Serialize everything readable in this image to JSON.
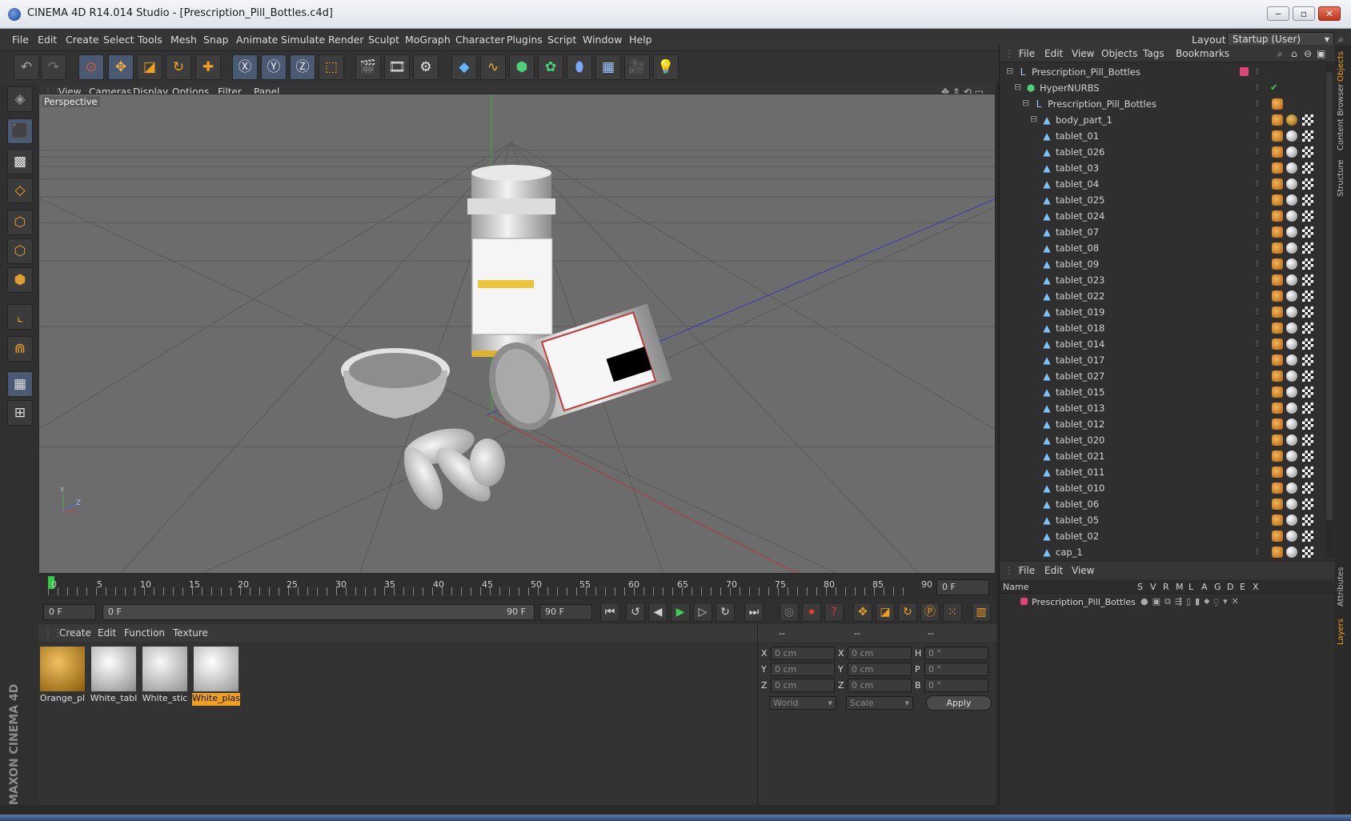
{
  "window": {
    "title": "CINEMA 4D R14.014 Studio - [Prescription_Pill_Bottles.c4d]",
    "minimize": "‒",
    "maximize": "▫",
    "close": "✕"
  },
  "menubar": {
    "items": [
      "File",
      "Edit",
      "Create",
      "Select",
      "Tools",
      "Mesh",
      "Snap",
      "Animate",
      "Simulate",
      "Render",
      "Sculpt",
      "MoGraph",
      "Character",
      "Plugins",
      "Script",
      "Window",
      "Help"
    ],
    "layout_label": "Layout:",
    "layout_value": "Startup (User)"
  },
  "viewport": {
    "menu": [
      "View",
      "Cameras",
      "Display",
      "Options",
      "Filter",
      "Panel"
    ],
    "label": "Perspective",
    "axis_y": "Y",
    "axis_z": "Z"
  },
  "timeline": {
    "ticks": [
      "0",
      "5",
      "10",
      "15",
      "20",
      "25",
      "30",
      "35",
      "40",
      "45",
      "50",
      "55",
      "60",
      "65",
      "70",
      "75",
      "80",
      "85",
      "90"
    ],
    "current_frame": "0 F"
  },
  "transport": {
    "start_field": "0 F",
    "range_start": "0 F",
    "range_end": "90 F",
    "end_field": "90 F"
  },
  "material_manager": {
    "menu": [
      "Create",
      "Edit",
      "Function",
      "Texture"
    ],
    "materials": [
      {
        "label": "Orange_pl",
        "color": "#c98b1a",
        "selected": false
      },
      {
        "label": "White_tabl",
        "color": "#d9d9d9",
        "selected": false
      },
      {
        "label": "White_stic",
        "color": "#cfcfcf",
        "selected": false
      },
      {
        "label": "White_plas",
        "color": "#dedede",
        "selected": true
      }
    ]
  },
  "coordinates": {
    "headers": [
      "--",
      "--",
      "--"
    ],
    "rows": [
      {
        "a": "X",
        "av": "0 cm",
        "b": "X",
        "bv": "0 cm",
        "c": "H",
        "cv": "0 °"
      },
      {
        "a": "Y",
        "av": "0 cm",
        "b": "Y",
        "bv": "0 cm",
        "c": "P",
        "cv": "0 °"
      },
      {
        "a": "Z",
        "av": "0 cm",
        "b": "Z",
        "bv": "0 cm",
        "c": "B",
        "cv": "0 °"
      }
    ],
    "space": "World",
    "mode": "Scale",
    "apply": "Apply"
  },
  "object_manager": {
    "menu": [
      "File",
      "Edit",
      "View",
      "Objects",
      "Tags",
      "Bookmarks"
    ],
    "objects": [
      {
        "name": "Prescription_Pill_Bottles",
        "indent": 0,
        "icon": "null"
      },
      {
        "name": "HyperNURBS",
        "indent": 1,
        "icon": "nurbs"
      },
      {
        "name": "Prescription_Pill_Bottles",
        "indent": 2,
        "icon": "null"
      },
      {
        "name": "body_part_1",
        "indent": 3,
        "icon": "poly"
      },
      {
        "name": "tablet_01",
        "indent": 3,
        "icon": "poly"
      },
      {
        "name": "tablet_026",
        "indent": 3,
        "icon": "poly"
      },
      {
        "name": "tablet_03",
        "indent": 3,
        "icon": "poly"
      },
      {
        "name": "tablet_04",
        "indent": 3,
        "icon": "poly"
      },
      {
        "name": "tablet_025",
        "indent": 3,
        "icon": "poly"
      },
      {
        "name": "tablet_024",
        "indent": 3,
        "icon": "poly"
      },
      {
        "name": "tablet_07",
        "indent": 3,
        "icon": "poly"
      },
      {
        "name": "tablet_08",
        "indent": 3,
        "icon": "poly"
      },
      {
        "name": "tablet_09",
        "indent": 3,
        "icon": "poly"
      },
      {
        "name": "tablet_023",
        "indent": 3,
        "icon": "poly"
      },
      {
        "name": "tablet_022",
        "indent": 3,
        "icon": "poly"
      },
      {
        "name": "tablet_019",
        "indent": 3,
        "icon": "poly"
      },
      {
        "name": "tablet_018",
        "indent": 3,
        "icon": "poly"
      },
      {
        "name": "tablet_014",
        "indent": 3,
        "icon": "poly"
      },
      {
        "name": "tablet_017",
        "indent": 3,
        "icon": "poly"
      },
      {
        "name": "tablet_027",
        "indent": 3,
        "icon": "poly"
      },
      {
        "name": "tablet_015",
        "indent": 3,
        "icon": "poly"
      },
      {
        "name": "tablet_013",
        "indent": 3,
        "icon": "poly"
      },
      {
        "name": "tablet_012",
        "indent": 3,
        "icon": "poly"
      },
      {
        "name": "tablet_020",
        "indent": 3,
        "icon": "poly"
      },
      {
        "name": "tablet_021",
        "indent": 3,
        "icon": "poly"
      },
      {
        "name": "tablet_011",
        "indent": 3,
        "icon": "poly"
      },
      {
        "name": "tablet_010",
        "indent": 3,
        "icon": "poly"
      },
      {
        "name": "tablet_06",
        "indent": 3,
        "icon": "poly"
      },
      {
        "name": "tablet_05",
        "indent": 3,
        "icon": "poly"
      },
      {
        "name": "tablet_02",
        "indent": 3,
        "icon": "poly"
      },
      {
        "name": "cap_1",
        "indent": 3,
        "icon": "poly"
      }
    ]
  },
  "layer_manager": {
    "menu": [
      "File",
      "Edit",
      "View"
    ],
    "columns": [
      "Name",
      "S",
      "V",
      "R",
      "M",
      "L",
      "A",
      "G",
      "D",
      "E",
      "X"
    ],
    "layers": [
      {
        "name": "Prescription_Pill_Bottles",
        "color": "#e0457a"
      }
    ]
  },
  "right_tabs": [
    "Objects",
    "Content Browser",
    "Structure",
    "Attributes",
    "Layers"
  ],
  "brand": "MAXON CINEMA 4D"
}
